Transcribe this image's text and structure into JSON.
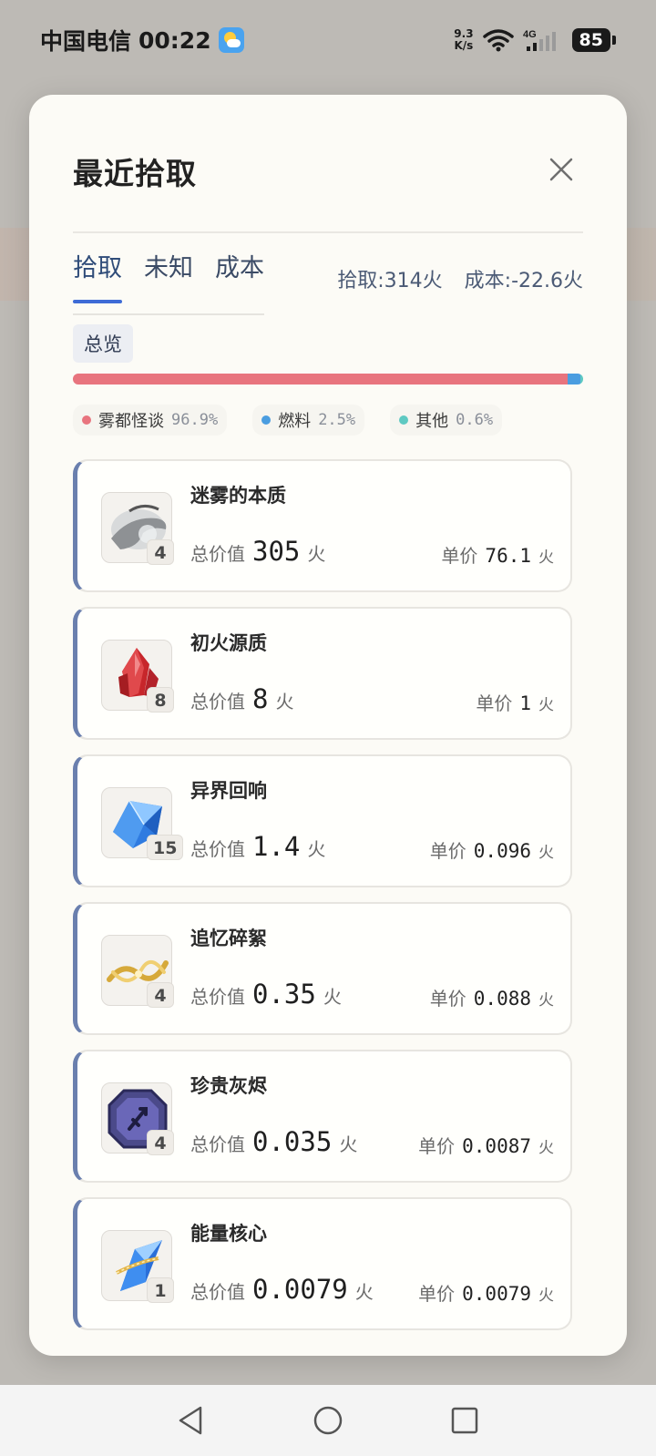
{
  "status_bar": {
    "carrier": "中国电信",
    "time": "00:22",
    "net_speed_value": "9.3",
    "net_speed_unit": "K/s",
    "network_type": "4G",
    "battery": "85"
  },
  "dialog": {
    "title": "最近拾取",
    "tabs": [
      {
        "label": "拾取",
        "active": true
      },
      {
        "label": "未知",
        "active": false
      },
      {
        "label": "成本",
        "active": false
      }
    ],
    "summary_pickup": "拾取:314火",
    "summary_cost": "成本:-22.6火",
    "overview_label": "总览",
    "distribution": [
      {
        "name": "雾都怪谈",
        "pct_label": "96.9%",
        "pct": 96.9,
        "color": "#e8747e"
      },
      {
        "name": "燃料",
        "pct_label": "2.5%",
        "pct": 2.5,
        "color": "#4a9de0"
      },
      {
        "name": "其他",
        "pct_label": "0.6%",
        "pct": 0.6,
        "color": "#5ec9c2"
      }
    ]
  },
  "labels": {
    "total": "总价值",
    "unit_price": "单价",
    "currency": "火"
  },
  "items": [
    {
      "name": "迷雾的本质",
      "count": "4",
      "total": "305",
      "unit": "76.1",
      "icon": "mist-hand-icon"
    },
    {
      "name": "初火源质",
      "count": "8",
      "total": "8",
      "unit": "1",
      "icon": "red-crystal-icon"
    },
    {
      "name": "异界回响",
      "count": "15",
      "total": "1.4",
      "unit": "0.096",
      "icon": "blue-crystal-icon"
    },
    {
      "name": "追忆碎絮",
      "count": "4",
      "total": "0.35",
      "unit": "0.088",
      "icon": "gold-ribbon-icon"
    },
    {
      "name": "珍贵灰烬",
      "count": "4",
      "total": "0.035",
      "unit": "0.0087",
      "icon": "purple-octagon-icon"
    },
    {
      "name": "能量核心",
      "count": "1",
      "total": "0.0079",
      "unit": "0.0079",
      "icon": "energy-core-icon"
    }
  ]
}
